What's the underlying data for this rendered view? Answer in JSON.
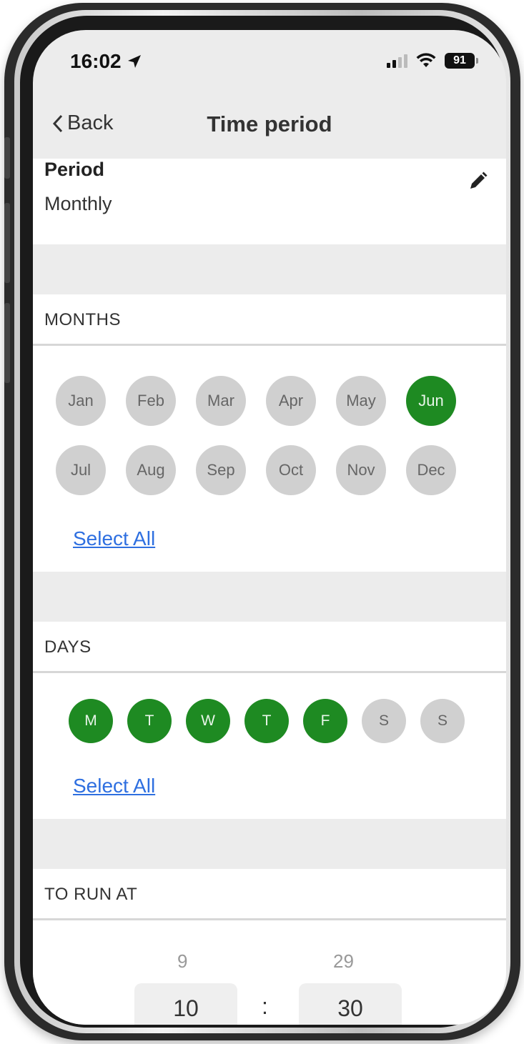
{
  "status": {
    "time": "16:02",
    "battery": "91"
  },
  "nav": {
    "back_label": "Back",
    "title": "Time period"
  },
  "period": {
    "label": "Period",
    "value": "Monthly"
  },
  "months": {
    "header": "MONTHS",
    "items": [
      {
        "label": "Jan",
        "selected": false
      },
      {
        "label": "Feb",
        "selected": false
      },
      {
        "label": "Mar",
        "selected": false
      },
      {
        "label": "Apr",
        "selected": false
      },
      {
        "label": "May",
        "selected": false
      },
      {
        "label": "Jun",
        "selected": true
      },
      {
        "label": "Jul",
        "selected": false
      },
      {
        "label": "Aug",
        "selected": false
      },
      {
        "label": "Sep",
        "selected": false
      },
      {
        "label": "Oct",
        "selected": false
      },
      {
        "label": "Nov",
        "selected": false
      },
      {
        "label": "Dec",
        "selected": false
      }
    ],
    "select_all": "Select All"
  },
  "days": {
    "header": "DAYS",
    "items": [
      {
        "label": "M",
        "selected": true
      },
      {
        "label": "T",
        "selected": true
      },
      {
        "label": "W",
        "selected": true
      },
      {
        "label": "T",
        "selected": true
      },
      {
        "label": "F",
        "selected": true
      },
      {
        "label": "S",
        "selected": false
      },
      {
        "label": "S",
        "selected": false
      }
    ],
    "select_all": "Select All"
  },
  "run_at": {
    "header": "TO RUN AT",
    "hour_prev": "9",
    "hour": "10",
    "separator": ":",
    "minute_prev": "29",
    "minute": "30"
  },
  "colors": {
    "selected": "#1e8a22",
    "unselected": "#d0d0d0",
    "link": "#2e6fe0"
  },
  "icons": {
    "location": "location-arrow-icon",
    "edit": "pencil-icon",
    "back": "chevron-left-icon"
  }
}
